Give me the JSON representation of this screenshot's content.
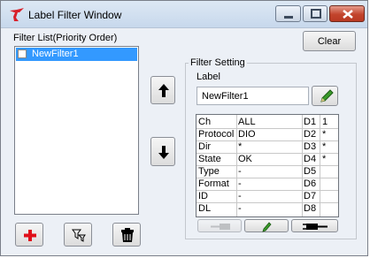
{
  "window": {
    "title": "Label Filter Window"
  },
  "filter_list": {
    "label": "Filter List(Priority Order)",
    "items": [
      {
        "label": "NewFilter1",
        "checked": false,
        "selected": true
      }
    ]
  },
  "buttons": {
    "clear": "Clear",
    "add_icon": "plus-icon",
    "filter_icon": "filter-icon",
    "delete_icon": "trash-icon",
    "move_up_icon": "arrow-up-icon",
    "move_down_icon": "arrow-down-icon",
    "edit_icon": "pencil-icon",
    "import_icon": "plug-left-icon",
    "export_icon": "plug-right-icon"
  },
  "filter_setting": {
    "group_label": "Filter Setting",
    "label_caption": "Label",
    "label_value": "NewFilter1",
    "rows": [
      {
        "name": "Ch",
        "value": "ALL",
        "d_name": "D1",
        "d_value": "1"
      },
      {
        "name": "Protocol",
        "value": "DIO",
        "d_name": "D2",
        "d_value": "*"
      },
      {
        "name": "Dir",
        "value": "*",
        "d_name": "D3",
        "d_value": "*"
      },
      {
        "name": "State",
        "value": "OK",
        "d_name": "D4",
        "d_value": "*"
      },
      {
        "name": "Type",
        "value": "-",
        "d_name": "D5",
        "d_value": ""
      },
      {
        "name": "Format",
        "value": "-",
        "d_name": "D6",
        "d_value": ""
      },
      {
        "name": "ID",
        "value": "-",
        "d_name": "D7",
        "d_value": ""
      },
      {
        "name": "DL",
        "value": "-",
        "d_name": "D8",
        "d_value": ""
      }
    ]
  },
  "colors": {
    "selection": "#3399ff",
    "accent_red": "#e0101a",
    "pencil_green": "#3a9a2a"
  }
}
